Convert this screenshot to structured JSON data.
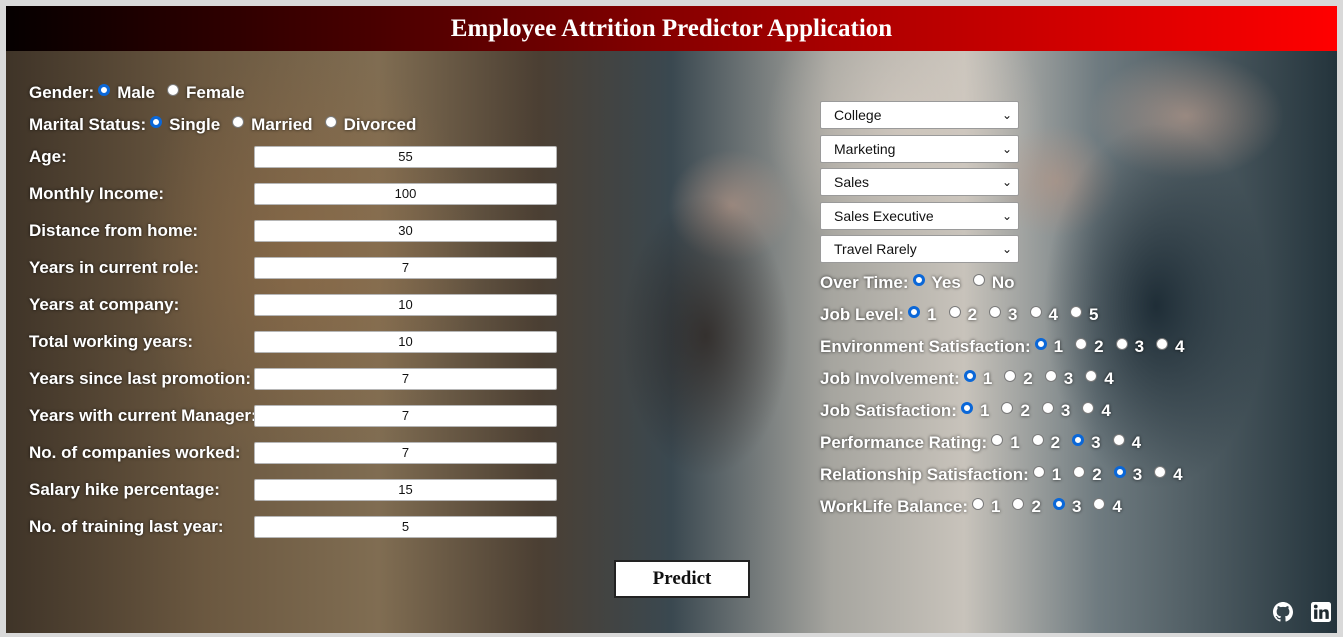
{
  "header": {
    "title": "Employee Attrition Predictor Application"
  },
  "gender": {
    "label": "Gender:",
    "options": [
      "Male",
      "Female"
    ],
    "selected": "Male"
  },
  "marital": {
    "label": "Marital Status:",
    "options": [
      "Single",
      "Married",
      "Divorced"
    ],
    "selected": "Single"
  },
  "fields": [
    {
      "label": "Age:",
      "value": "55"
    },
    {
      "label": "Monthly Income:",
      "value": "100"
    },
    {
      "label": "Distance from home:",
      "value": "30"
    },
    {
      "label": "Years in current role:",
      "value": "7"
    },
    {
      "label": "Years at company:",
      "value": "10"
    },
    {
      "label": "Total working years:",
      "value": "10"
    },
    {
      "label": "Years since last promotion:",
      "value": "7"
    },
    {
      "label": "Years with current Manager:",
      "value": "7"
    },
    {
      "label": "No. of companies worked:",
      "value": "7"
    },
    {
      "label": "Salary hike percentage:",
      "value": "15"
    },
    {
      "label": "No. of training last year:",
      "value": "5"
    }
  ],
  "selects": [
    "College",
    "Marketing",
    "Sales",
    "Sales Executive",
    "Travel Rarely"
  ],
  "overtime": {
    "label": "Over Time:",
    "options": [
      "Yes",
      "No"
    ],
    "selected": "Yes"
  },
  "ratings": [
    {
      "label": "Job Level:",
      "options": [
        "1",
        "2",
        "3",
        "4",
        "5"
      ],
      "selected": "1"
    },
    {
      "label": "Environment Satisfaction:",
      "options": [
        "1",
        "2",
        "3",
        "4"
      ],
      "selected": "1"
    },
    {
      "label": "Job Involvement:",
      "options": [
        "1",
        "2",
        "3",
        "4"
      ],
      "selected": "1"
    },
    {
      "label": "Job Satisfaction:",
      "options": [
        "1",
        "2",
        "3",
        "4"
      ],
      "selected": "1"
    },
    {
      "label": "Performance Rating:",
      "options": [
        "1",
        "2",
        "3",
        "4"
      ],
      "selected": "3"
    },
    {
      "label": "Relationship Satisfaction:",
      "options": [
        "1",
        "2",
        "3",
        "4"
      ],
      "selected": "3"
    },
    {
      "label": "WorkLife Balance:",
      "options": [
        "1",
        "2",
        "3",
        "4"
      ],
      "selected": "3"
    }
  ],
  "predict_label": "Predict",
  "icons": {
    "github": "github-icon",
    "linkedin": "linkedin-icon"
  },
  "colors": {
    "accent_radio": "#0a67d8",
    "header_start": "#050000",
    "header_end": "#ff0000"
  }
}
